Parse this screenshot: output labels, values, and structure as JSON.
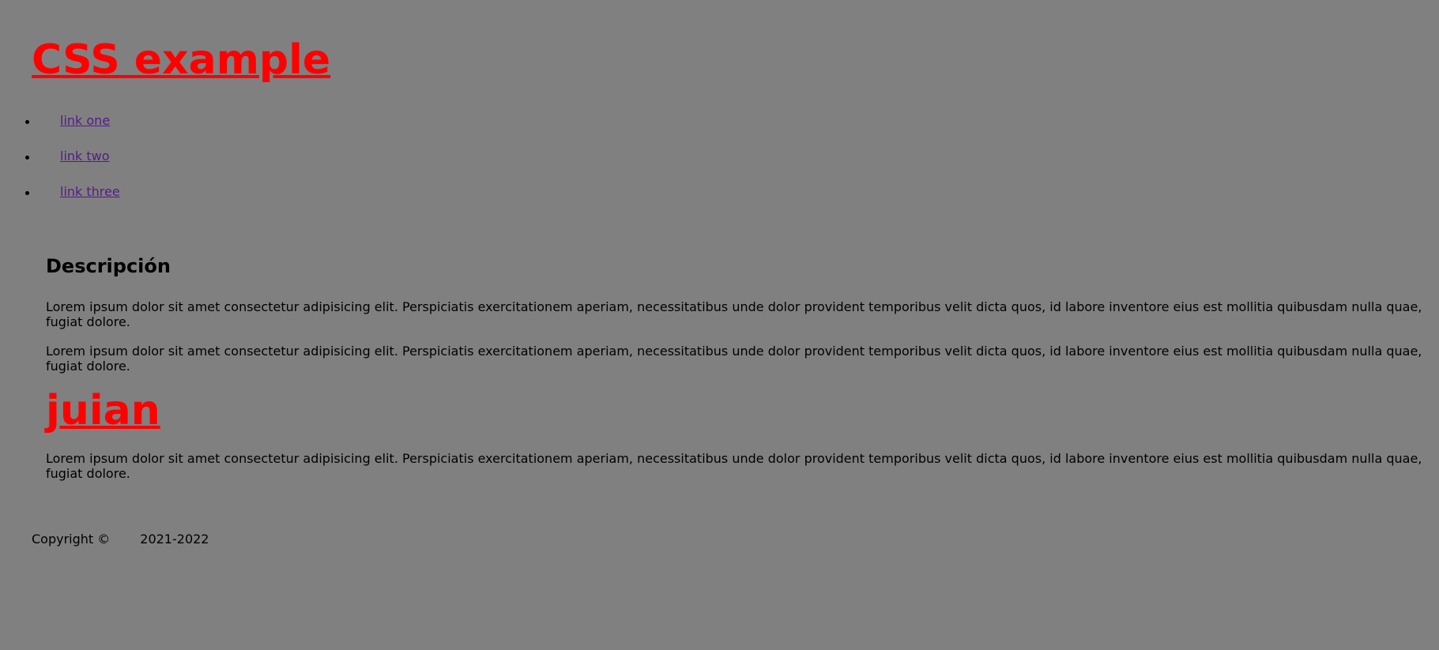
{
  "header": {
    "title": "CSS example"
  },
  "nav": {
    "items": [
      {
        "label": "link one"
      },
      {
        "label": "link two"
      },
      {
        "label": "link three"
      }
    ]
  },
  "main": {
    "heading": "Descripción",
    "paragraph_1": "Lorem ipsum dolor sit amet consectetur adipisicing elit. Perspiciatis exercitationem aperiam, necessitatibus unde dolor provident temporibus velit dicta quos, id labore inventore eius est mollitia quibusdam nulla quae, fugiat dolore.",
    "paragraph_2": "Lorem ipsum dolor sit amet consectetur adipisicing elit. Perspiciatis exercitationem aperiam, necessitatibus unde dolor provident temporibus velit dicta quos, id labore inventore eius est mollitia quibusdam nulla quae, fugiat dolore.",
    "subtitle": "juian",
    "paragraph_3": "Lorem ipsum dolor sit amet consectetur adipisicing elit. Perspiciatis exercitationem aperiam, necessitatibus unde dolor provident temporibus velit dicta quos, id labore inventore eius est mollitia quibusdam nulla quae, fugiat dolore."
  },
  "footer": {
    "copyright": "Copyright ©",
    "years": "2021-2022"
  },
  "colors": {
    "background": "#808080",
    "heading_red": "#ff0000",
    "visited_link": "#551a8b",
    "text": "#000000"
  }
}
